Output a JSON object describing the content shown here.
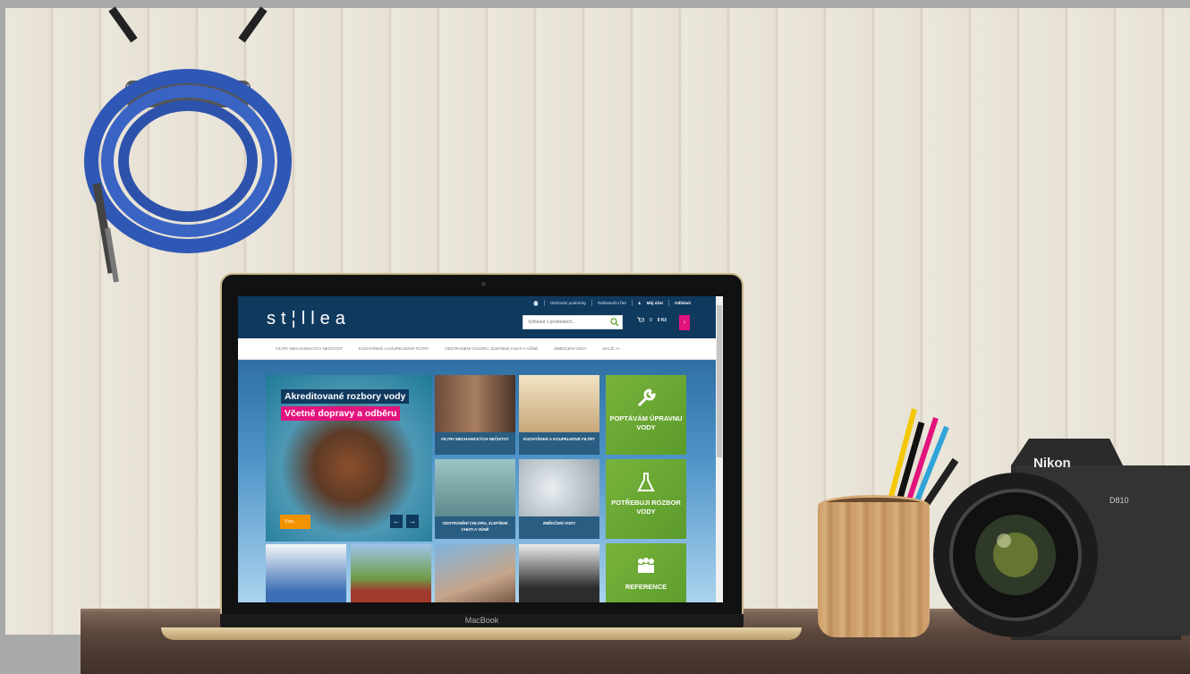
{
  "site": {
    "logo": "st¦llea",
    "top_links": [
      "Obchodní podmínky",
      "Reklamační řád",
      "Můj účet",
      "Odhlásit"
    ],
    "search_placeholder": "Vyhledat v produktech...",
    "cart_count": "0",
    "cart_price": "0 Kč",
    "cart_arrow": "›"
  },
  "nav": {
    "items": [
      "Filtry mechanických nečistot",
      "Kuchyňské a koupelnové filtry",
      "Odstranění chloru, zlepšení chuti a vůně",
      "Změkčení vody",
      "Další >>"
    ]
  },
  "hero": {
    "title": "Akreditované rozbory vody",
    "subtitle": "Včetně dopravy a odběru",
    "button": "Více...",
    "prev": "←",
    "next": "→"
  },
  "tiles": [
    {
      "caption": "Filtry mechanických nečistot"
    },
    {
      "caption": "Kuchyňské a koupelnové filtry"
    },
    {
      "caption": "Odstranění chloru, zlepšení chuti a vůně"
    },
    {
      "caption": "Změkčení vody"
    }
  ],
  "green_tiles": [
    {
      "label": "Poptávám úpravnu vody",
      "icon": "wrench-icon"
    },
    {
      "label": "Potřebuji rozbor vody",
      "icon": "flask-icon"
    },
    {
      "label": "Reference",
      "icon": "people-icon"
    }
  ],
  "laptop": {
    "brand": "MacBook"
  },
  "camera": {
    "brand": "Nikon",
    "model": "D810"
  },
  "colors": {
    "header": "#10395e",
    "accent_pink": "#e2137d",
    "accent_orange": "#f39200",
    "green": "#6aa532"
  }
}
